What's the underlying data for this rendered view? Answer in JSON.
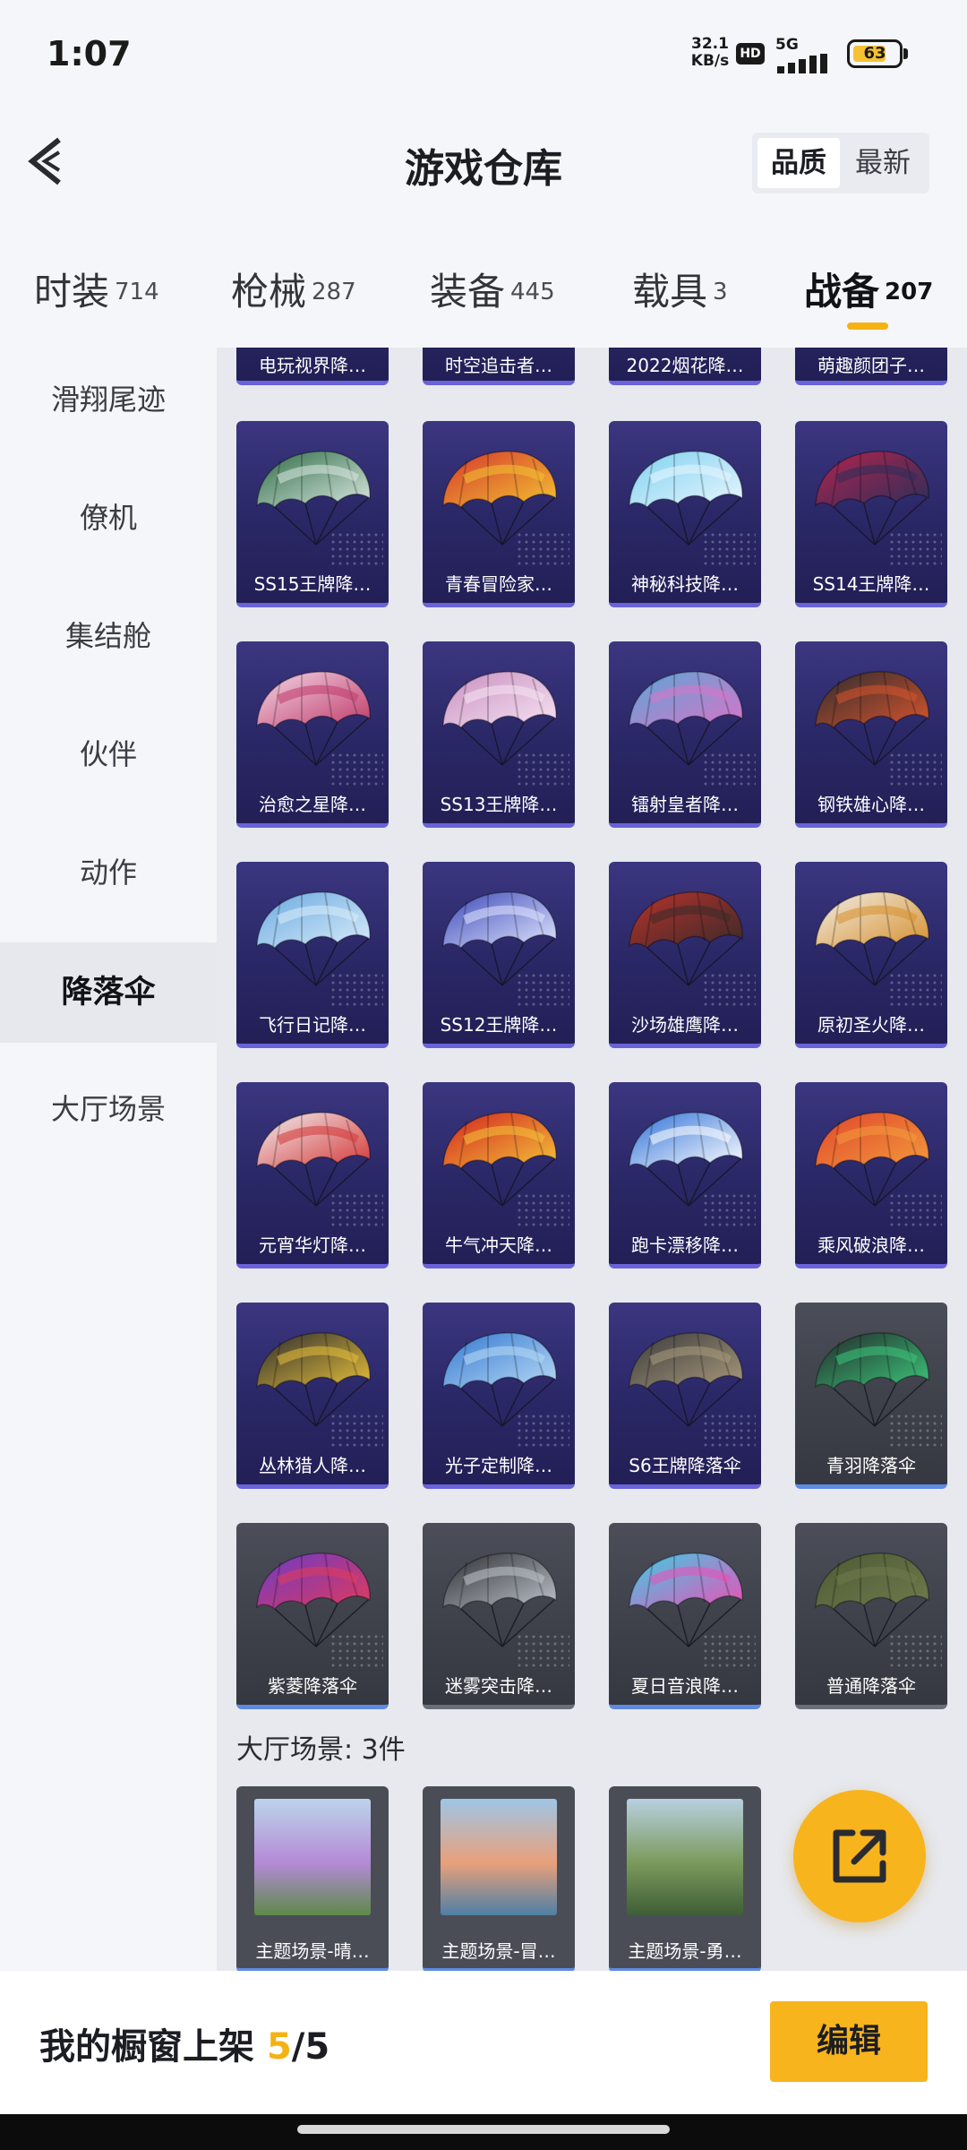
{
  "status_bar": {
    "time": "1:07",
    "net_speed_value": "32.1",
    "net_speed_unit": "KB/s",
    "hd": "HD",
    "network": "5G",
    "battery": "63"
  },
  "header": {
    "title": "游戏仓库",
    "sort_options": [
      "品质",
      "最新"
    ],
    "active_sort": "品质"
  },
  "tabs": [
    {
      "label": "时装",
      "count": "714"
    },
    {
      "label": "枪械",
      "count": "287"
    },
    {
      "label": "装备",
      "count": "445"
    },
    {
      "label": "载具",
      "count": "3"
    },
    {
      "label": "战备",
      "count": "207"
    }
  ],
  "active_tab": "战备",
  "sidebar": {
    "items": [
      "滑翔尾迹",
      "僚机",
      "集结舱",
      "伙伴",
      "动作",
      "降落伞",
      "大厅场景"
    ],
    "active": "降落伞"
  },
  "items": [
    {
      "name": "电玩视界降…",
      "colors": [
        "#6a56c8",
        "#e24e88"
      ],
      "style": "purple"
    },
    {
      "name": "时空追击者…",
      "colors": [
        "#3f5ad8",
        "#d9dde6"
      ],
      "style": "purple"
    },
    {
      "name": "2022烟花降…",
      "colors": [
        "#d4465a",
        "#f2c34c"
      ],
      "style": "purple"
    },
    {
      "name": "萌趣颜团子…",
      "colors": [
        "#f08ab5",
        "#ffffff"
      ],
      "style": "purple"
    },
    {
      "name": "SS15王牌降…",
      "colors": [
        "#2f6b46",
        "#d8e8e0"
      ],
      "style": "purple"
    },
    {
      "name": "青春冒险家…",
      "colors": [
        "#d6372d",
        "#f2c232"
      ],
      "style": "purple"
    },
    {
      "name": "神秘科技降…",
      "colors": [
        "#7fd1f0",
        "#e8f6ff"
      ],
      "style": "purple"
    },
    {
      "name": "SS14王牌降…",
      "colors": [
        "#b2244e",
        "#2c2e5a"
      ],
      "style": "purple"
    },
    {
      "name": "治愈之星降…",
      "colors": [
        "#f3d6e6",
        "#c03b6a"
      ],
      "style": "purple"
    },
    {
      "name": "SS13王牌降…",
      "colors": [
        "#c98fc1",
        "#f6e3f2"
      ],
      "style": "purple"
    },
    {
      "name": "镭射皇者降…",
      "colors": [
        "#5aa6d6",
        "#d874c9"
      ],
      "style": "purple"
    },
    {
      "name": "钢铁雄心降…",
      "colors": [
        "#2c2c30",
        "#d7542c"
      ],
      "style": "purple"
    },
    {
      "name": "飞行日记降…",
      "colors": [
        "#6aa9e0",
        "#d8ecfa"
      ],
      "style": "purple"
    },
    {
      "name": "SS12王牌降…",
      "colors": [
        "#3d49b8",
        "#e0e6ff"
      ],
      "style": "purple"
    },
    {
      "name": "沙场雄鹰降…",
      "colors": [
        "#b8322c",
        "#3a2a2a"
      ],
      "style": "purple"
    },
    {
      "name": "原初圣火降…",
      "colors": [
        "#f1eee7",
        "#d6902e"
      ],
      "style": "purple"
    },
    {
      "name": "元宵华灯降…",
      "colors": [
        "#f2f0f2",
        "#d43636"
      ],
      "style": "purple"
    },
    {
      "name": "牛气冲天降…",
      "colors": [
        "#d2231f",
        "#f4c23a"
      ],
      "style": "purple"
    },
    {
      "name": "跑卡漂移降…",
      "colors": [
        "#2f72d8",
        "#ffffff"
      ],
      "style": "purple"
    },
    {
      "name": "乘风破浪降…",
      "colors": [
        "#e0462c",
        "#f39a3c"
      ],
      "style": "purple"
    },
    {
      "name": "丛林猎人降…",
      "colors": [
        "#2b2b30",
        "#e8c03a"
      ],
      "style": "purple"
    },
    {
      "name": "光子定制降…",
      "colors": [
        "#3478d0",
        "#b8daf6"
      ],
      "style": "purple"
    },
    {
      "name": "S6王牌降落伞",
      "colors": [
        "#3a3a3c",
        "#a99a7c"
      ],
      "style": "purple"
    },
    {
      "name": "青羽降落伞",
      "colors": [
        "#23272b",
        "#3cc77a"
      ],
      "style": "gray"
    },
    {
      "name": "紫菱降落伞",
      "colors": [
        "#6a3bc8",
        "#e23a5a"
      ],
      "style": "gray"
    },
    {
      "name": "迷雾突击降…",
      "colors": [
        "#2c2e33",
        "#bfc4cc"
      ],
      "style": "gray-plain"
    },
    {
      "name": "夏日音浪降…",
      "colors": [
        "#3ad0e6",
        "#ec4fb6"
      ],
      "style": "gray"
    },
    {
      "name": "普通降落伞",
      "colors": [
        "#4d5a34",
        "#6f7a4c"
      ],
      "style": "gray-plain"
    }
  ],
  "section": {
    "title": "大厅场景: 3件"
  },
  "scenes": [
    {
      "name": "主题场景-晴…",
      "colors": [
        "#bcd4ec",
        "#b48ad6",
        "#5e8a4a"
      ]
    },
    {
      "name": "主题场景-冒…",
      "colors": [
        "#9ec6e6",
        "#e9a07a",
        "#4f7fa6"
      ]
    },
    {
      "name": "主题场景-勇…",
      "colors": [
        "#b8d0e0",
        "#7a9a5c",
        "#3f5e36"
      ]
    }
  ],
  "bottom_bar": {
    "label": "我的橱窗上架",
    "count": "5",
    "total": "/5",
    "edit_label": "编辑"
  }
}
